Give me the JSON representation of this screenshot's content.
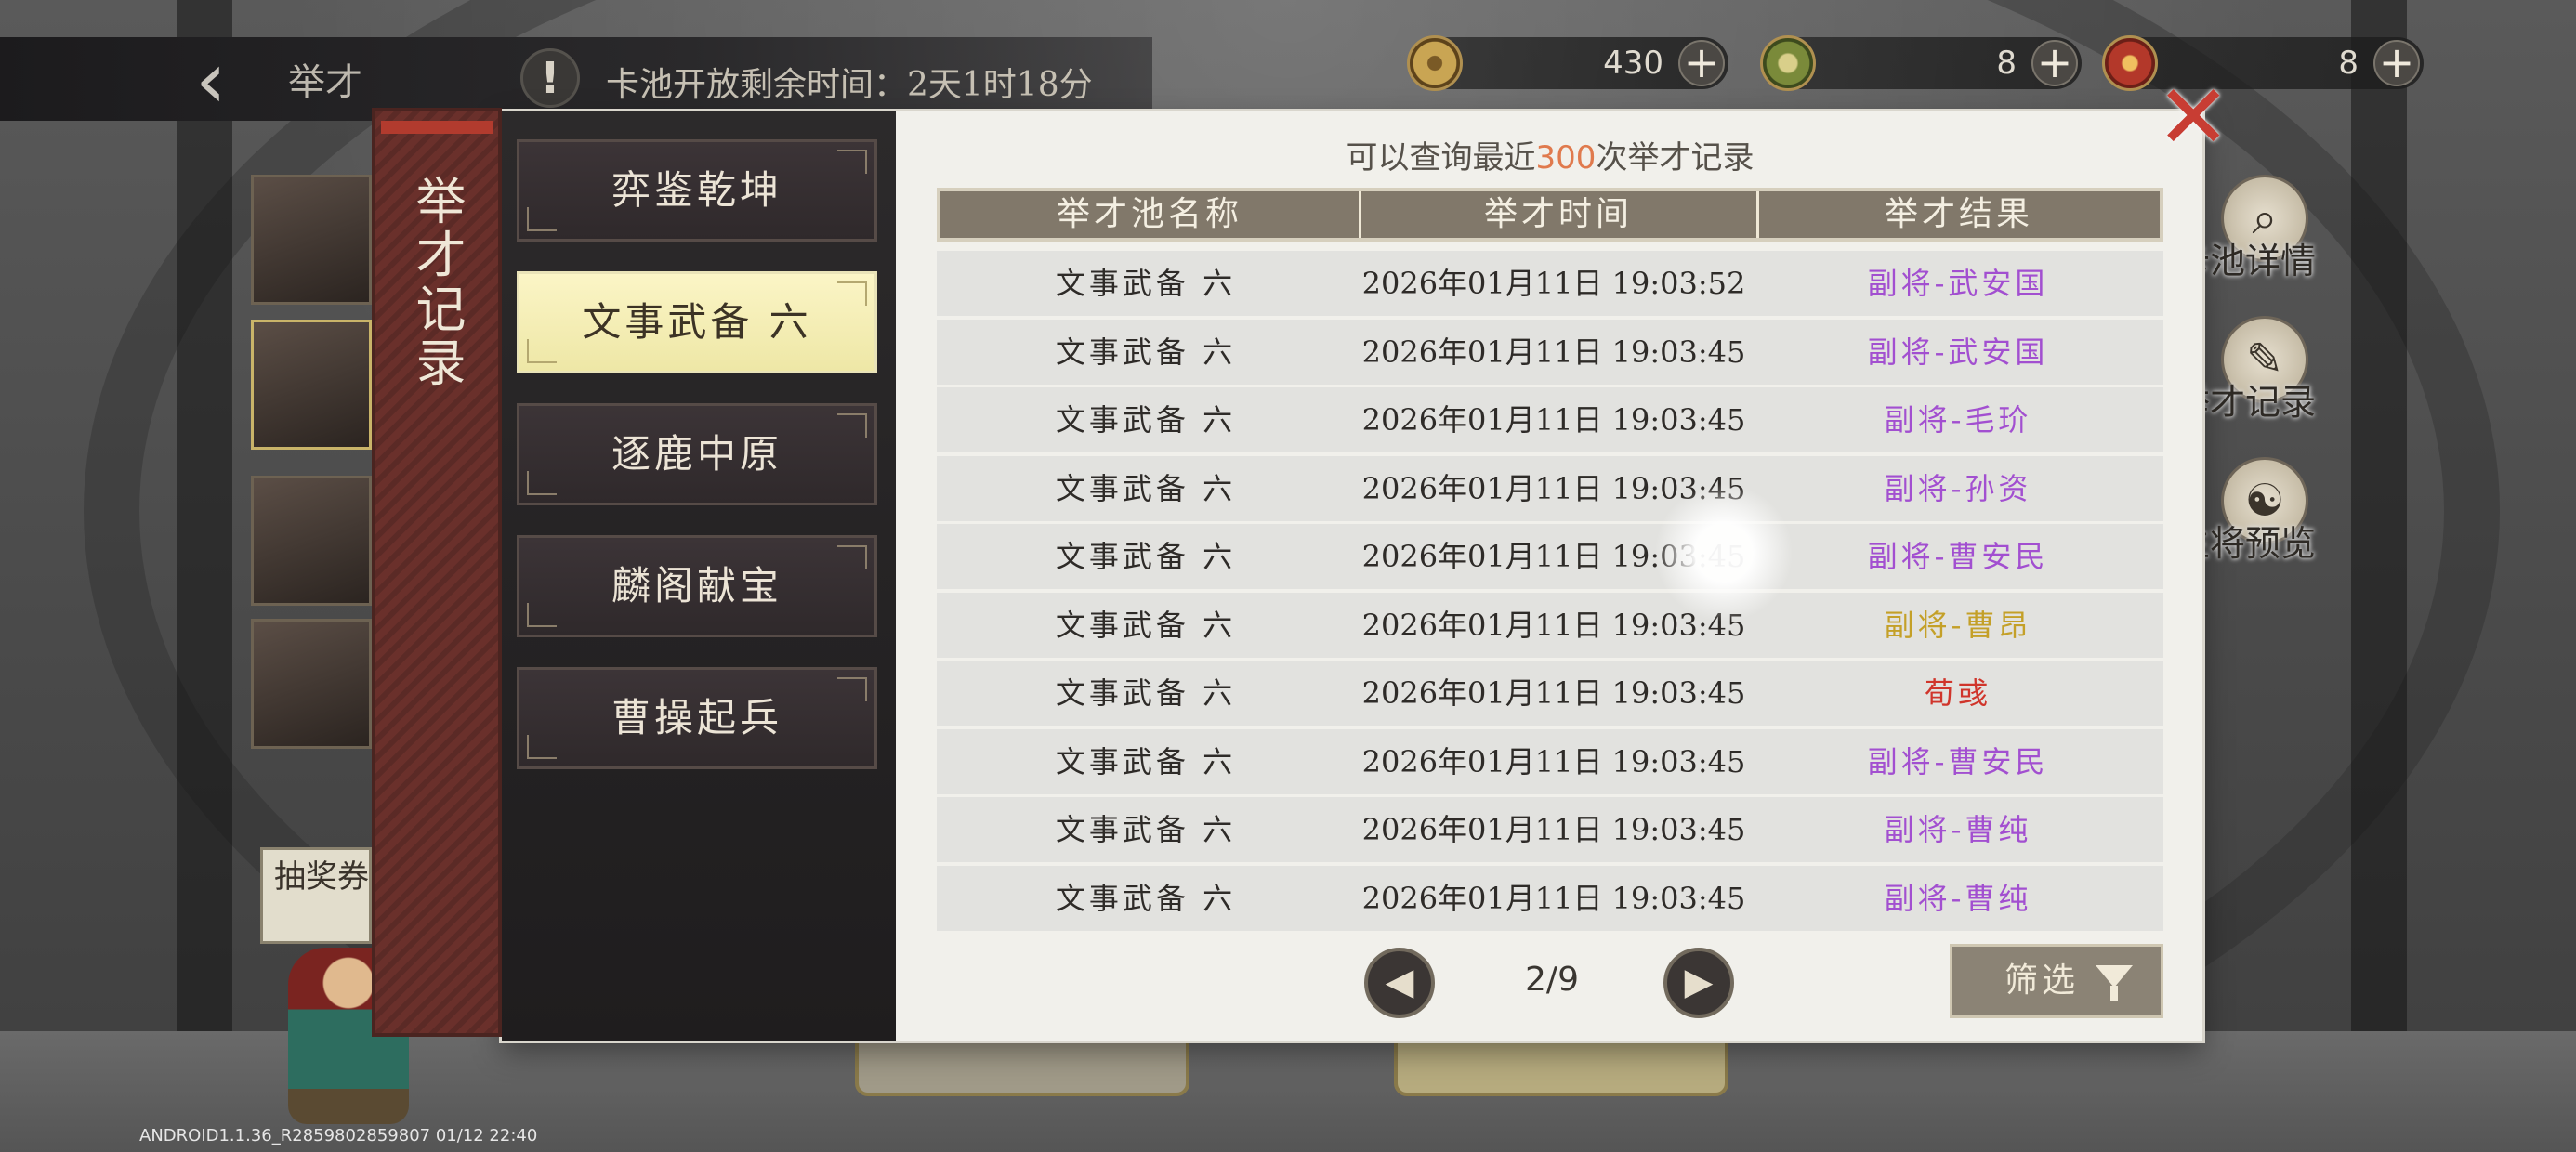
{
  "topbar": {
    "back_icon": "chevron-left-icon",
    "title": "举才",
    "info_icon": "exclamation-icon",
    "timer_text": "卡池开放剩余时间：2天1时18分"
  },
  "currencies": [
    {
      "icon": "coin-icon",
      "value": "430",
      "plus": "+"
    },
    {
      "icon": "jade-icon",
      "value": "8",
      "plus": "+"
    },
    {
      "icon": "seal-icon",
      "value": "8",
      "plus": "+"
    }
  ],
  "side_buttons": [
    {
      "icon": "magnifier-icon",
      "label": "卡池详情"
    },
    {
      "icon": "scroll-icon",
      "label": "举才记录"
    },
    {
      "icon": "general-icon",
      "label": "主将预览"
    }
  ],
  "background": {
    "collect_tag": "抽奖券收集攻",
    "version": "ANDROID1.1.36_R2859802859807 01/12 22:40"
  },
  "dialog": {
    "vertical_title": "举才记录",
    "pool_tabs": [
      "弈鉴乾坤",
      "文事武备 六",
      "逐鹿中原",
      "麟阁献宝",
      "曹操起兵"
    ],
    "active_tab_index": 1,
    "header_prefix": "可以查询最近",
    "header_count": "300",
    "header_suffix": "次举才记录",
    "columns": [
      "举才池名称",
      "举才时间",
      "举才结果"
    ],
    "rows": [
      {
        "pool": "文事武备 六",
        "time": "2026年01月11日 19:03:52",
        "result": "副将-武安国",
        "color": "#a24fd0"
      },
      {
        "pool": "文事武备 六",
        "time": "2026年01月11日 19:03:45",
        "result": "副将-武安国",
        "color": "#a24fd0"
      },
      {
        "pool": "文事武备 六",
        "time": "2026年01月11日 19:03:45",
        "result": "副将-毛玠",
        "color": "#a24fd0"
      },
      {
        "pool": "文事武备 六",
        "time": "2026年01月11日 19:03:45",
        "result": "副将-孙资",
        "color": "#a24fd0"
      },
      {
        "pool": "文事武备 六",
        "time": "2026年01月11日 19:03:45",
        "result": "副将-曹安民",
        "color": "#a24fd0"
      },
      {
        "pool": "文事武备 六",
        "time": "2026年01月11日 19:03:45",
        "result": "副将-曹昂",
        "color": "#c4a028"
      },
      {
        "pool": "文事武备 六",
        "time": "2026年01月11日 19:03:45",
        "result": "荀彧",
        "color": "#d0352b"
      },
      {
        "pool": "文事武备 六",
        "time": "2026年01月11日 19:03:45",
        "result": "副将-曹安民",
        "color": "#a24fd0"
      },
      {
        "pool": "文事武备 六",
        "time": "2026年01月11日 19:03:45",
        "result": "副将-曹纯",
        "color": "#a24fd0"
      },
      {
        "pool": "文事武备 六",
        "time": "2026年01月11日 19:03:45",
        "result": "副将-曹纯",
        "color": "#a24fd0"
      }
    ],
    "pager": {
      "prev_icon": "arrow-left-icon",
      "next_icon": "arrow-right-icon",
      "page_text": "2/9"
    },
    "filter_label": "筛选",
    "filter_icon": "funnel-icon",
    "close_icon": "close-icon"
  }
}
